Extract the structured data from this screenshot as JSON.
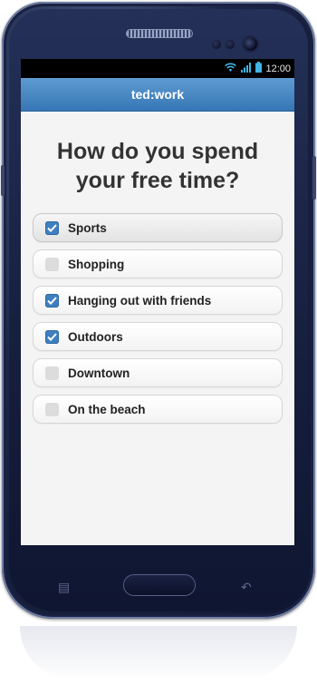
{
  "status_bar": {
    "time": "12:00"
  },
  "app_bar": {
    "title": "ted:work"
  },
  "question": {
    "line1": "How do you spend",
    "line2": "your free time?"
  },
  "options": [
    {
      "label": "Sports",
      "checked": true
    },
    {
      "label": "Shopping",
      "checked": false
    },
    {
      "label": "Hanging out with friends",
      "checked": true
    },
    {
      "label": "Outdoors",
      "checked": true
    },
    {
      "label": "Downtown",
      "checked": false
    },
    {
      "label": "On the beach",
      "checked": false
    }
  ],
  "colors": {
    "app_bar": "#3f80bd",
    "checkbox_checked": "#3f7fbf",
    "checkbox_unchecked": "#dcdcdc",
    "phone_body": "#1d2648"
  }
}
